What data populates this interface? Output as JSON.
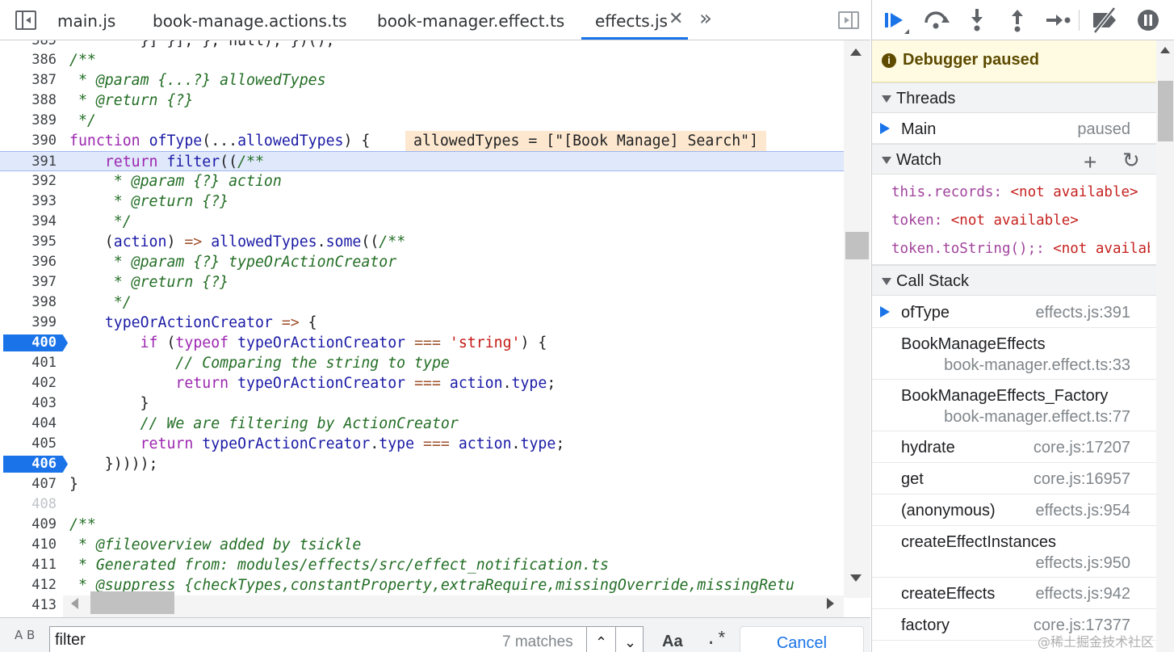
{
  "tabs": [
    {
      "label": "main.js"
    },
    {
      "label": "book-manage.actions.ts"
    },
    {
      "label": "book-manager.effect.ts"
    },
    {
      "label": "effects.js"
    }
  ],
  "icons": {
    "close": "✕",
    "more": "»",
    "up": "⌃",
    "down": "⌄",
    "plus": "+",
    "refresh": "↻",
    "info": "i",
    "replace": "A B"
  },
  "editor": {
    "partial_top_line": "        }] }], }, null); })();",
    "partial_top_num": "385",
    "inline_value": "allowedTypes = [\"[Book Manage] Search\"]",
    "lines": [
      {
        "n": "386",
        "text": "/**"
      },
      {
        "n": "387",
        "text": " * @param {...?} allowedTypes"
      },
      {
        "n": "388",
        "text": " * @return {?}"
      },
      {
        "n": "389",
        "text": " */"
      },
      {
        "n": "390",
        "text": "function ofType(...allowedTypes) {"
      },
      {
        "n": "391",
        "text": "    return filter((/**"
      },
      {
        "n": "392",
        "text": "     * @param {?} action"
      },
      {
        "n": "393",
        "text": "     * @return {?}"
      },
      {
        "n": "394",
        "text": "     */"
      },
      {
        "n": "395",
        "text": "    (action) => allowedTypes.some((/**"
      },
      {
        "n": "396",
        "text": "     * @param {?} typeOrActionCreator"
      },
      {
        "n": "397",
        "text": "     * @return {?}"
      },
      {
        "n": "398",
        "text": "     */"
      },
      {
        "n": "399",
        "text": "    typeOrActionCreator => {"
      },
      {
        "n": "400",
        "text": "        if (typeof typeOrActionCreator === 'string') {"
      },
      {
        "n": "401",
        "text": "            // Comparing the string to type"
      },
      {
        "n": "402",
        "text": "            return typeOrActionCreator === action.type;"
      },
      {
        "n": "403",
        "text": "        }"
      },
      {
        "n": "404",
        "text": "        // We are filtering by ActionCreator"
      },
      {
        "n": "405",
        "text": "        return typeOrActionCreator.type === action.type;"
      },
      {
        "n": "406",
        "text": "    }))));"
      },
      {
        "n": "407",
        "text": "}"
      },
      {
        "n": "408",
        "text": ""
      },
      {
        "n": "409",
        "text": "/**"
      },
      {
        "n": "410",
        "text": " * @fileoverview added by tsickle"
      },
      {
        "n": "411",
        "text": " * Generated from: modules/effects/src/effect_notification.ts"
      },
      {
        "n": "412",
        "text": " * @suppress {checkTypes,constantProperty,extraRequire,missingOverride,missingRetu"
      },
      {
        "n": "413",
        "text": ""
      }
    ]
  },
  "search": {
    "value": "filter",
    "match_count": "7 matches",
    "match_case_label": "Aa",
    "regex_label": ".*",
    "cancel_label": "Cancel"
  },
  "debugger": {
    "paused_text": "Debugger paused",
    "threads_title": "Threads",
    "thread_name": "Main",
    "thread_status": "paused",
    "watch_title": "Watch",
    "watch": [
      {
        "name": "this.records",
        "value": "<not available>"
      },
      {
        "name": "token",
        "value": "<not available>"
      },
      {
        "name": "token.toString();",
        "value": "<not available>"
      }
    ],
    "callstack_title": "Call Stack",
    "frames": [
      {
        "name": "ofType",
        "loc": "effects.js:391"
      },
      {
        "name": "BookManageEffects",
        "loc": "book-manager.effect.ts:33"
      },
      {
        "name": "BookManageEffects_Factory",
        "loc": "book-manager.effect.ts:77"
      },
      {
        "name": "hydrate",
        "loc": "core.js:17207"
      },
      {
        "name": "get",
        "loc": "core.js:16957"
      },
      {
        "name": "(anonymous)",
        "loc": "effects.js:954"
      },
      {
        "name": "createEffectInstances",
        "loc": "effects.js:950"
      },
      {
        "name": "createEffects",
        "loc": "effects.js:942"
      },
      {
        "name": "factory",
        "loc": "core.js:17377"
      }
    ]
  },
  "watermark": "@稀土掘金技术社区",
  "colors": {
    "accent": "#1a73e8",
    "paused_bg": "#fffbe2",
    "inline_bg": "#fde8cf"
  }
}
